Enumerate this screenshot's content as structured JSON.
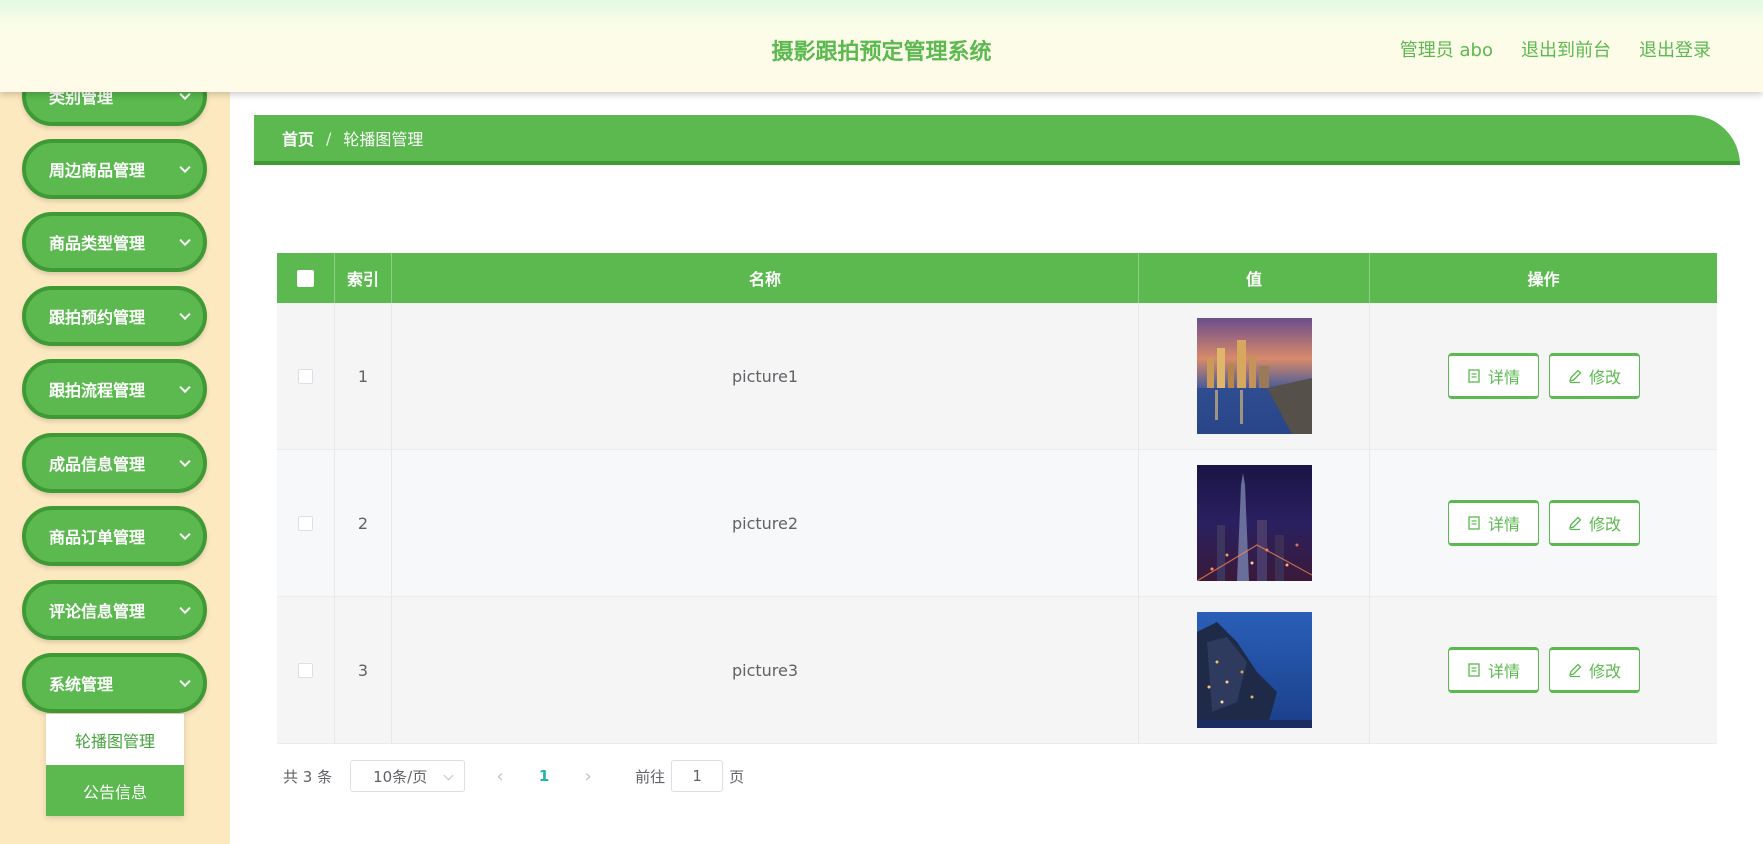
{
  "header": {
    "title": "摄影跟拍预定管理系统",
    "admin": "管理员 abo",
    "exit_front": "退出到前台",
    "logout": "退出登录"
  },
  "sidebar": {
    "items": [
      {
        "label": "类别管理"
      },
      {
        "label": "周边商品管理"
      },
      {
        "label": "商品类型管理"
      },
      {
        "label": "跟拍预约管理"
      },
      {
        "label": "跟拍流程管理"
      },
      {
        "label": "成品信息管理"
      },
      {
        "label": "商品订单管理"
      },
      {
        "label": "评论信息管理"
      },
      {
        "label": "系统管理"
      }
    ],
    "submenu": [
      {
        "label": "轮播图管理",
        "active": true
      },
      {
        "label": "公告信息",
        "active": false
      }
    ]
  },
  "breadcrumb": {
    "home": "首页",
    "separator": "/",
    "current": "轮播图管理"
  },
  "table": {
    "headers": [
      "索引",
      "名称",
      "值",
      "操作"
    ],
    "rows": [
      {
        "index": "1",
        "name": "picture1"
      },
      {
        "index": "2",
        "name": "picture2"
      },
      {
        "index": "3",
        "name": "picture3"
      }
    ],
    "detail_label": "详情",
    "edit_label": "修改"
  },
  "pagination": {
    "total": "共 3 条",
    "page_size": "10条/页",
    "current_page": "1",
    "goto_prefix": "前往",
    "goto_value": "1",
    "goto_suffix": "页"
  },
  "colors": {
    "primary": "#5bb94f",
    "primary_dark": "#3f9a36",
    "sidebar_bg": "#fde9c0",
    "page_active": "#21b6a5"
  }
}
